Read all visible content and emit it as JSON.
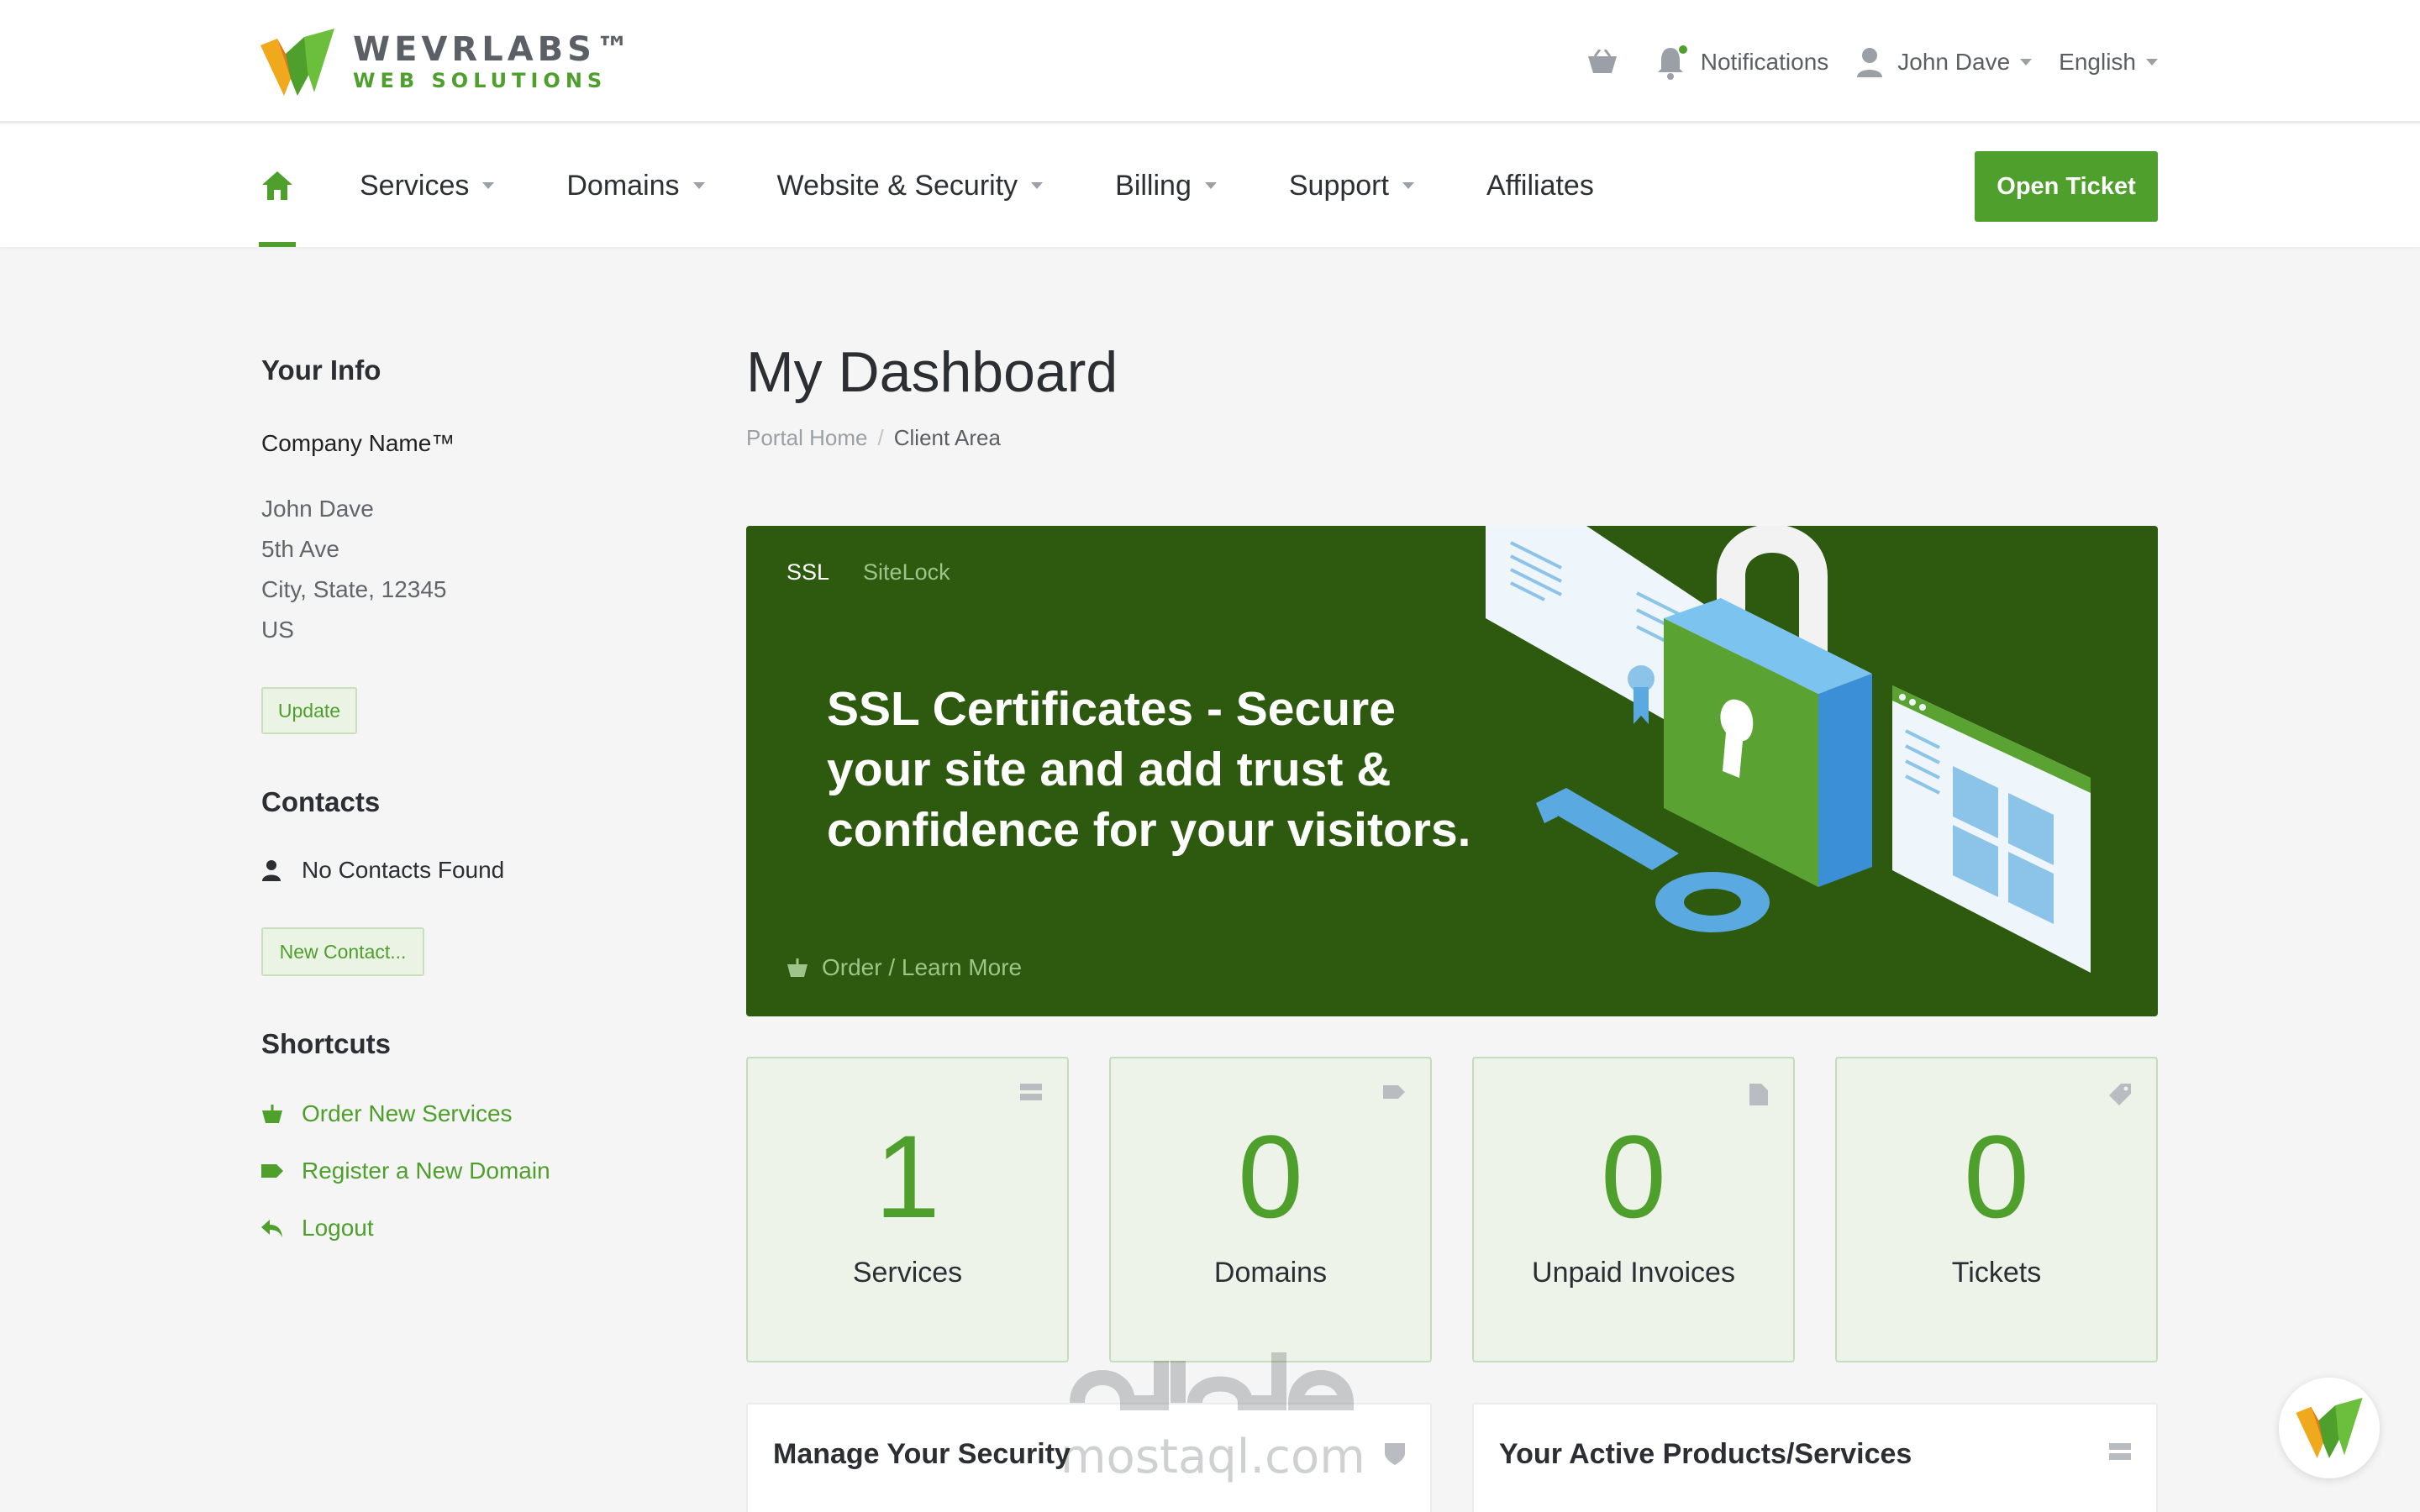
{
  "brand": {
    "name": "WEVRLABS™",
    "tagline": "WEB SOLUTIONS"
  },
  "header": {
    "notifications_label": "Notifications",
    "user_name": "John Dave",
    "language": "English"
  },
  "nav": {
    "items": [
      {
        "label": "Services",
        "dropdown": true
      },
      {
        "label": "Domains",
        "dropdown": true
      },
      {
        "label": "Website & Security",
        "dropdown": true
      },
      {
        "label": "Billing",
        "dropdown": true
      },
      {
        "label": "Support",
        "dropdown": true
      },
      {
        "label": "Affiliates",
        "dropdown": false
      }
    ],
    "open_ticket_label": "Open Ticket"
  },
  "sidebar": {
    "your_info_heading": "Your Info",
    "company_name": "Company Name™",
    "address_lines": [
      "John Dave",
      "5th Ave",
      "City, State, 12345",
      "US"
    ],
    "update_label": "Update",
    "contacts_heading": "Contacts",
    "no_contacts": "No Contacts Found",
    "new_contact_label": "New Contact...",
    "shortcuts_heading": "Shortcuts",
    "shortcuts": [
      "Order New Services",
      "Register a New Domain",
      "Logout"
    ]
  },
  "page": {
    "title": "My Dashboard",
    "breadcrumb": [
      "Portal Home",
      "Client Area"
    ]
  },
  "promo": {
    "tabs": [
      "SSL",
      "SiteLock"
    ],
    "headline_lines": [
      "SSL Certificates - Secure",
      "your site and add trust &",
      "confidence for your visitors."
    ],
    "link_label": "Order / Learn More"
  },
  "stats": [
    {
      "value": "1",
      "label": "Services",
      "icon": "server-icon"
    },
    {
      "value": "0",
      "label": "Domains",
      "icon": "tag-icon"
    },
    {
      "value": "0",
      "label": "Unpaid Invoices",
      "icon": "document-icon"
    },
    {
      "value": "0",
      "label": "Tickets",
      "icon": "ticket-icon"
    }
  ],
  "panels": {
    "security_title": "Manage Your Security",
    "products_title": "Your Active Products/Services"
  },
  "watermark": {
    "text": "mostaql.com"
  },
  "colors": {
    "brand_green": "#4e9f2c",
    "promo_green": "#2d5a0f"
  }
}
